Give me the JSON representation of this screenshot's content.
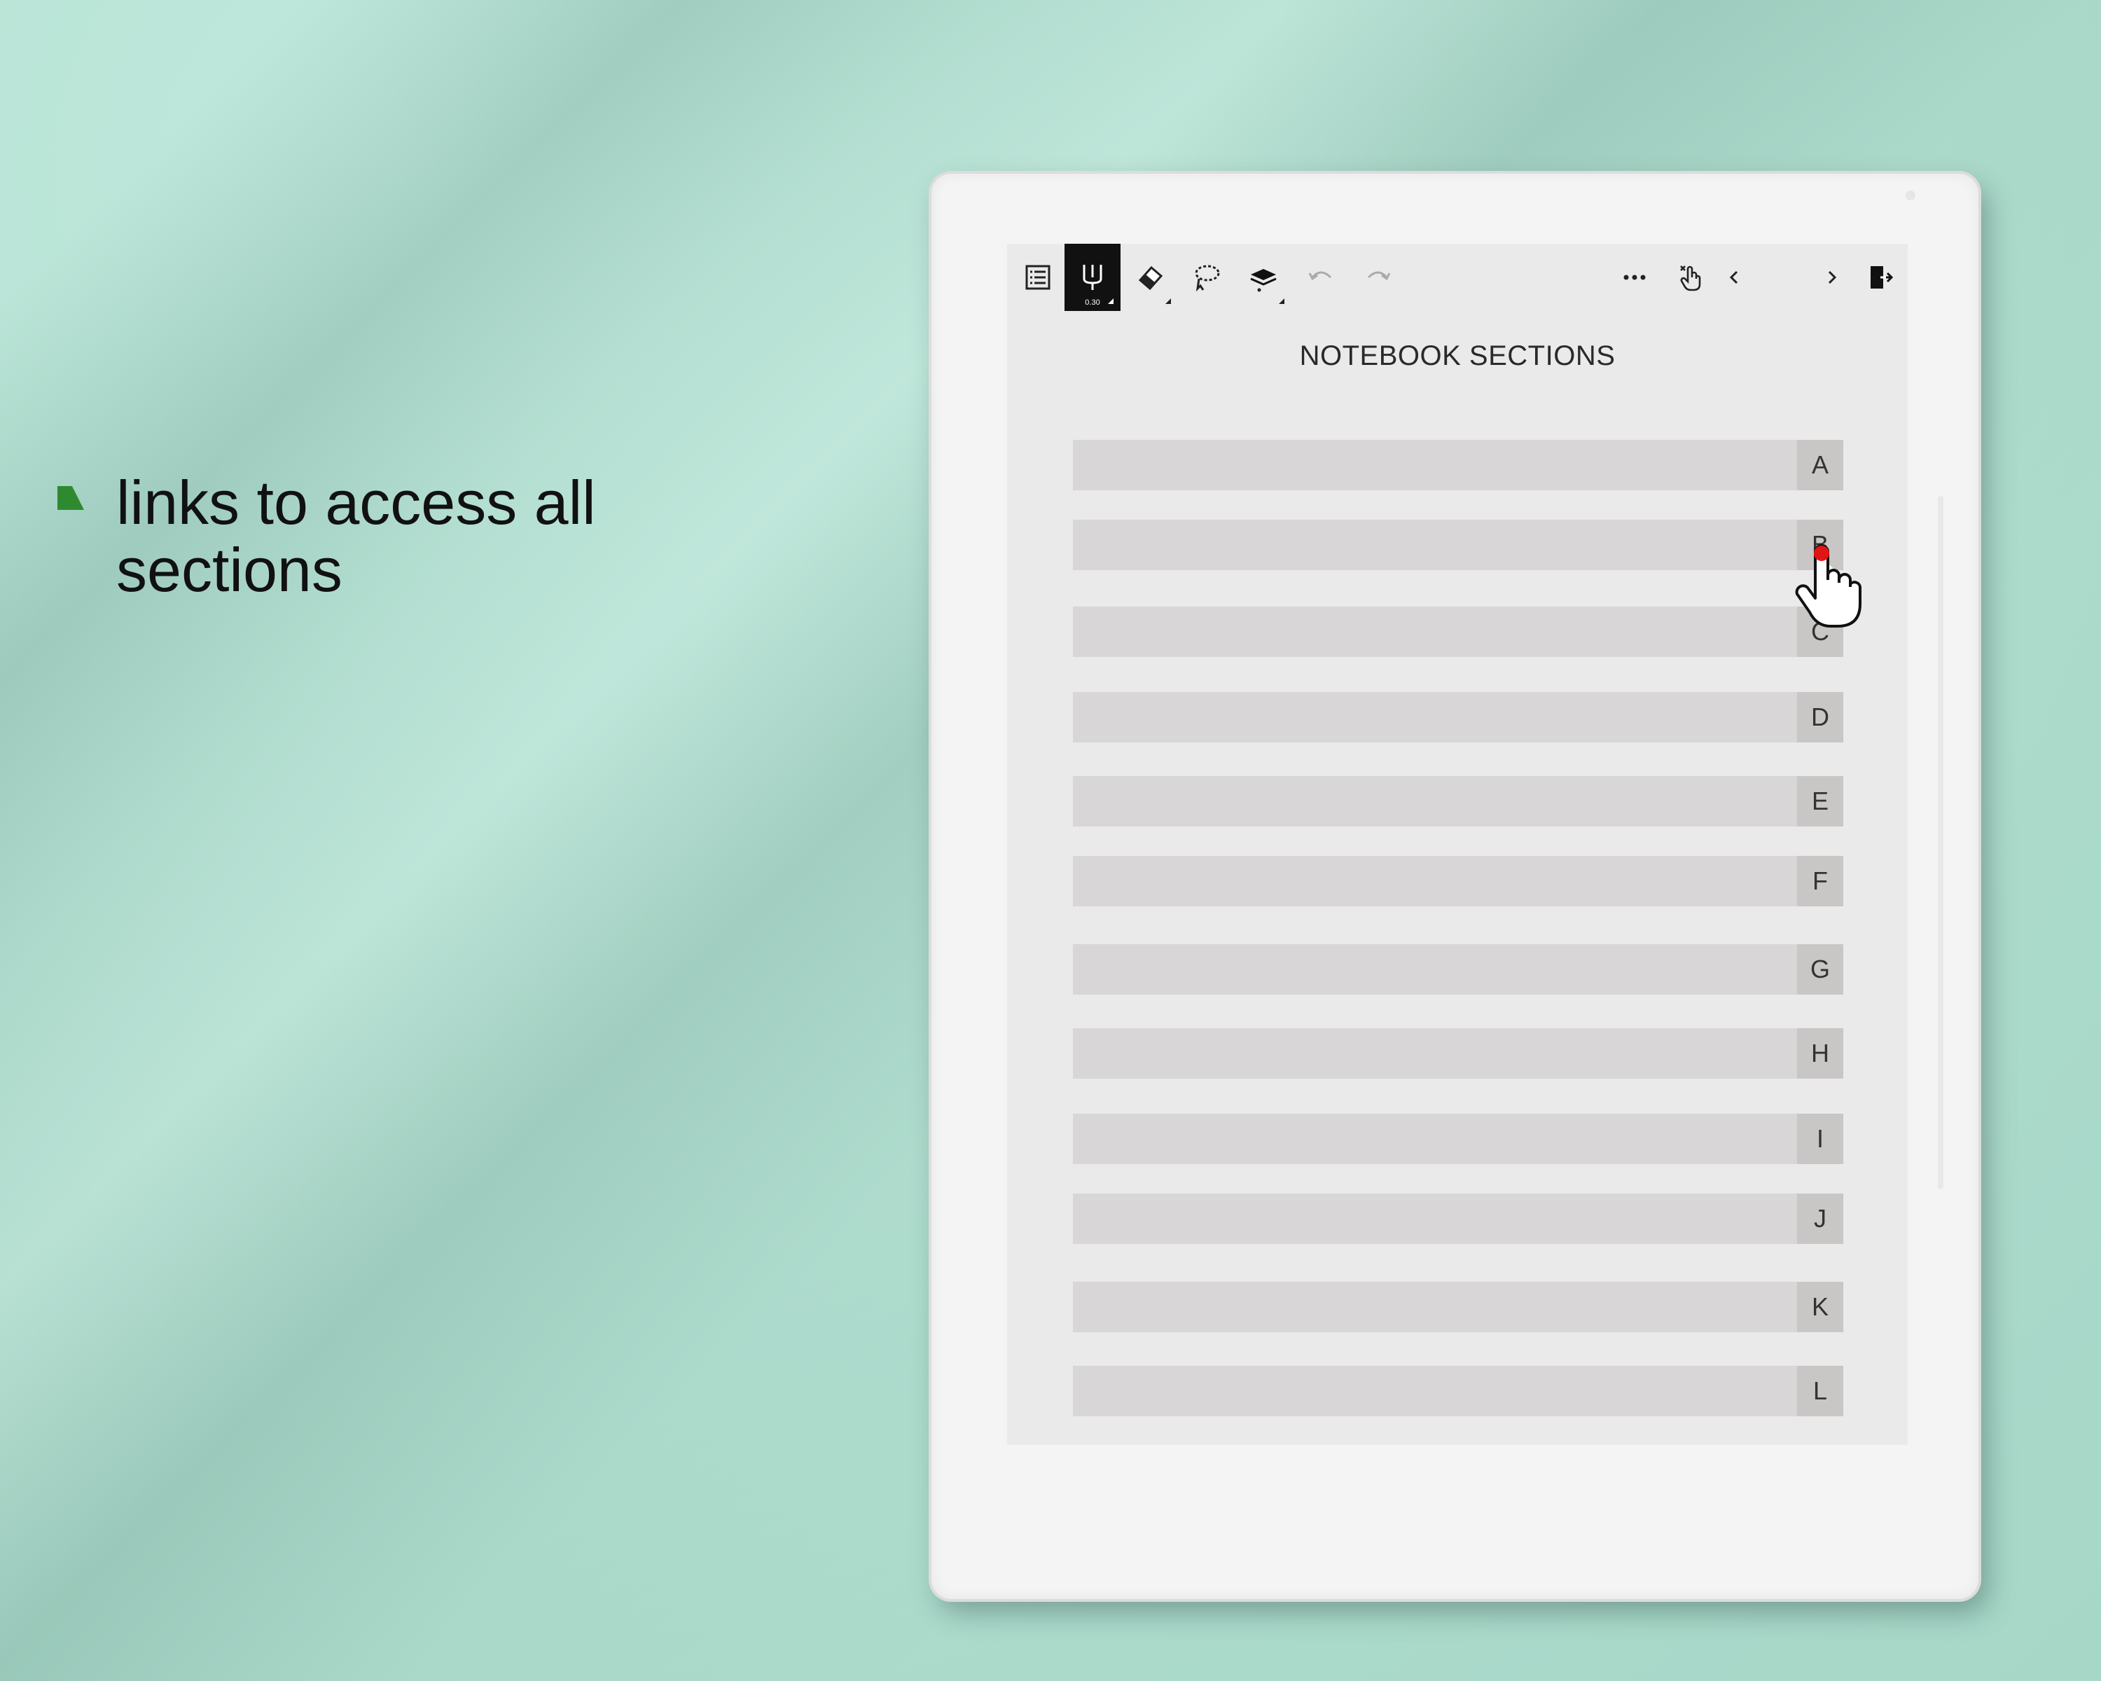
{
  "caption": {
    "text": "links to access all sections"
  },
  "toolbar": {
    "pen_size": "0.30"
  },
  "page": {
    "title": "NOTEBOOK SECTIONS"
  },
  "sections": [
    {
      "letter": "A"
    },
    {
      "letter": "B"
    },
    {
      "letter": "C"
    },
    {
      "letter": "D"
    },
    {
      "letter": "E"
    },
    {
      "letter": "F"
    },
    {
      "letter": "G"
    },
    {
      "letter": "H"
    },
    {
      "letter": "I"
    },
    {
      "letter": "J"
    },
    {
      "letter": "K"
    },
    {
      "letter": "L"
    }
  ],
  "colors": {
    "background": "#b3e0d2",
    "bullet": "#2f8a2f",
    "row": "#d8d6d6",
    "letter_tab": "#c9c6c6",
    "cursor_dot": "#e01515"
  }
}
